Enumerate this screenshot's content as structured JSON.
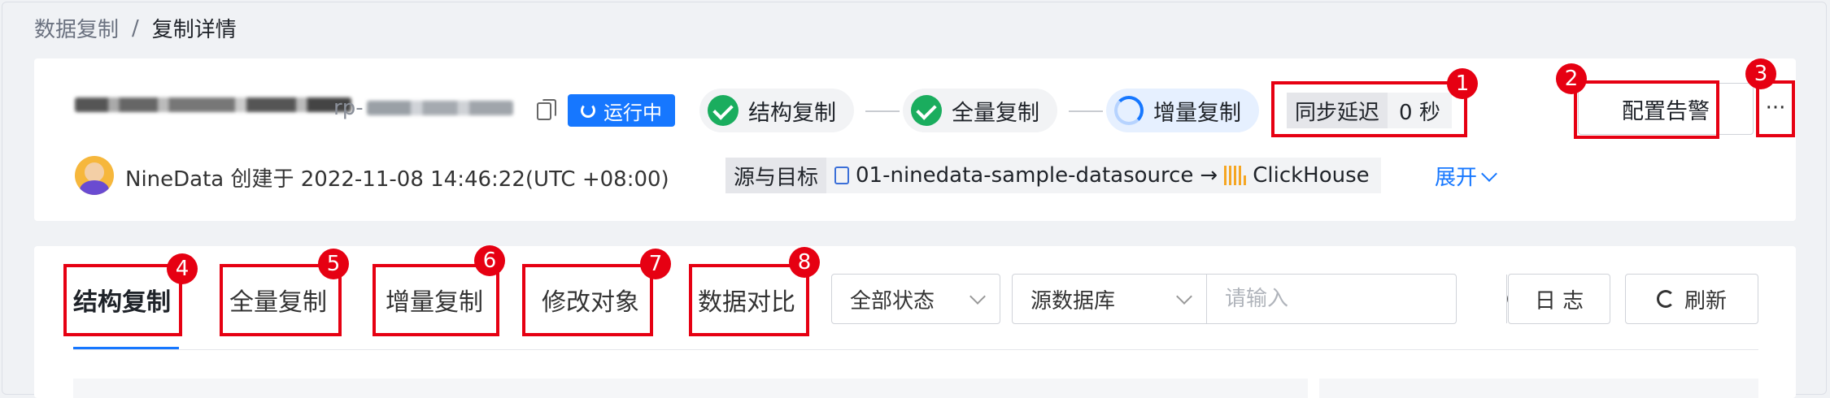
{
  "breadcrumb": {
    "parent": "数据复制",
    "separator": "/",
    "current": "复制详情"
  },
  "task": {
    "id_prefix": "rp-",
    "status": "运行中"
  },
  "stages": [
    {
      "label": "结构复制",
      "state": "done"
    },
    {
      "label": "全量复制",
      "state": "done"
    },
    {
      "label": "增量复制",
      "state": "running"
    }
  ],
  "latency": {
    "label": "同步延迟",
    "value": "0 秒"
  },
  "actions": {
    "alert_label": "配置告警",
    "more_label": "···"
  },
  "meta": {
    "creator_line": "NineData 创建于 2022-11-08 14:46:22(UTC +08:00)",
    "src_target_label": "源与目标",
    "source": "01-ninedata-sample-datasource",
    "arrow": "→",
    "target": "ClickHouse",
    "expand_label": "展开"
  },
  "tabs": [
    {
      "label": "结构复制",
      "active": true
    },
    {
      "label": "全量复制"
    },
    {
      "label": "增量复制"
    },
    {
      "label": "修改对象"
    },
    {
      "label": "数据对比"
    }
  ],
  "filters": {
    "status_select": "全部状态",
    "db_select": "源数据库",
    "search_placeholder": "请输入",
    "log_button": "日 志",
    "refresh_button": "刷新"
  },
  "annotations": [
    "1",
    "2",
    "3",
    "4",
    "5",
    "6",
    "7",
    "8"
  ],
  "colors": {
    "accent": "#1677ff",
    "success": "#1aad5e",
    "annotation": "#e60012"
  }
}
